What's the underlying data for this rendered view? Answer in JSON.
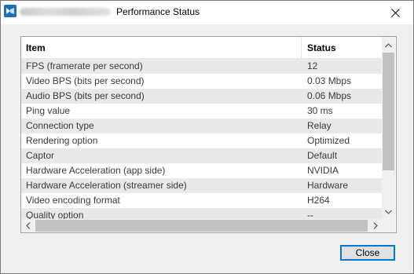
{
  "window": {
    "title": "Performance Status",
    "close_glyph": "✕"
  },
  "table": {
    "columns": [
      "Item",
      "Status"
    ],
    "rows": [
      {
        "item": "FPS (framerate per second)",
        "status": "12"
      },
      {
        "item": "Video BPS (bits per second)",
        "status": "0.03 Mbps"
      },
      {
        "item": "Audio BPS (bits per second)",
        "status": "0.06 Mbps"
      },
      {
        "item": "Ping value",
        "status": "30 ms"
      },
      {
        "item": "Connection type",
        "status": "Relay"
      },
      {
        "item": "Rendering option",
        "status": "Optimized"
      },
      {
        "item": "Captor",
        "status": "Default"
      },
      {
        "item": "Hardware Acceleration (app side)",
        "status": "NVIDIA"
      },
      {
        "item": "Hardware Acceleration (streamer side)",
        "status": "Hardware"
      },
      {
        "item": "Video encoding format",
        "status": "H264"
      },
      {
        "item": "Quality option",
        "status": "--"
      }
    ]
  },
  "footer": {
    "close_label": "Close"
  },
  "colors": {
    "accent": "#0078d7",
    "alt_row": "#e9e9e9",
    "app_icon": "#1f6fb8"
  }
}
